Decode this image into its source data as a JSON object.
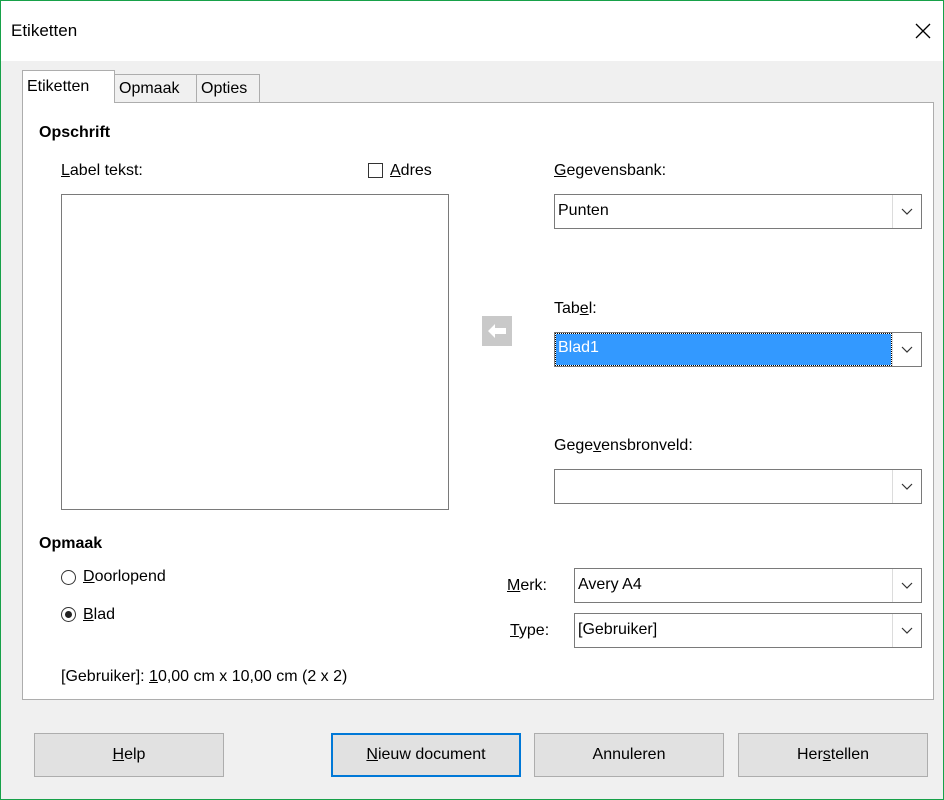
{
  "window": {
    "title": "Etiketten",
    "close_icon": "close-icon"
  },
  "tabs": [
    {
      "label": "Etiketten",
      "active": true
    },
    {
      "label": "Opmaak",
      "active": false
    },
    {
      "label": "Opties",
      "active": false
    }
  ],
  "opschrift": {
    "heading": "Opschrift",
    "label_text": {
      "first": "L",
      "rest": "abel tekst:"
    },
    "label_value": "",
    "adres": {
      "first": "A",
      "rest": "dres",
      "checked": false
    }
  },
  "database": {
    "label": {
      "first": "G",
      "rest": "egevensbank:"
    },
    "value": "Punten"
  },
  "table": {
    "label": {
      "pre": "Tab",
      "u": "e",
      "post": "l:"
    },
    "value": "Blad1"
  },
  "field": {
    "label": {
      "pre": "Gege",
      "u": "v",
      "post": "ensbronveld:"
    },
    "value": ""
  },
  "insert_arrow_icon": "arrow-left-icon",
  "opmaak": {
    "heading": "Opmaak",
    "doorlopend": {
      "first": "D",
      "rest": "oorlopend",
      "selected": false
    },
    "blad": {
      "first": "B",
      "rest": "lad",
      "selected": true
    }
  },
  "merk": {
    "label": {
      "first": "M",
      "rest": "erk:"
    },
    "value": "Avery A4"
  },
  "type": {
    "label": {
      "first": "T",
      "rest": "ype:"
    },
    "value": "[Gebruiker]"
  },
  "summary": {
    "pre": "[Gebruiker]: ",
    "u": "1",
    "post": "0,00 cm x 10,00 cm (2 x 2)"
  },
  "buttons": {
    "help": {
      "first": "H",
      "rest": "elp"
    },
    "new_document": {
      "first": "N",
      "rest": "ieuw document"
    },
    "cancel": {
      "label": "Annuleren"
    },
    "reset": {
      "pre": "Her",
      "u": "s",
      "post": "tellen"
    }
  },
  "colors": {
    "accent": "#0078d7",
    "selection": "#3399ff",
    "window_border": "#17a149"
  }
}
